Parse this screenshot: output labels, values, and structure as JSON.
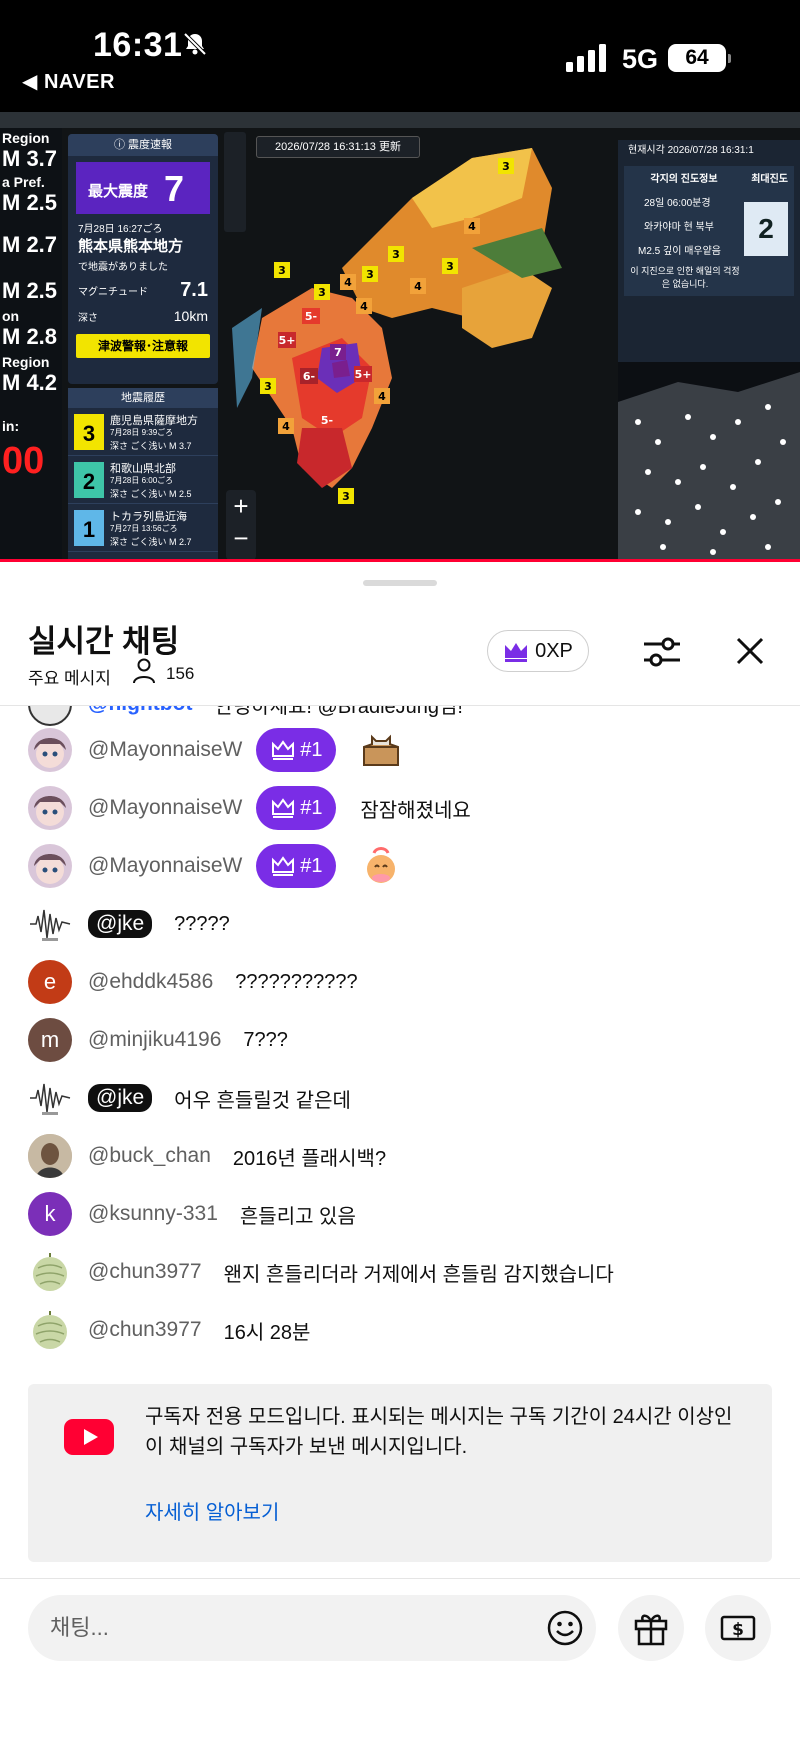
{
  "status_bar": {
    "time": "16:31",
    "back_label": "◀ NAVER",
    "network": "5G",
    "battery": "64"
  },
  "video": {
    "left_labels": [
      "Region",
      "M 3.7",
      "a Pref.",
      "M 2.5",
      "M 2.7",
      "M 2.5",
      "on",
      "M 2.8",
      "Region",
      "M 4.2",
      "in:",
      "00"
    ],
    "panel": {
      "header": "ⓘ 震度速報",
      "max_label": "最大震度",
      "max_value": "7",
      "date": "7月28日 16:27ごろ",
      "place": "熊本県熊本地方",
      "occurred": "で地震がありました",
      "magnitude_label": "マグニチュード",
      "magnitude_value": "7.1",
      "depth_label": "深さ",
      "depth_value": "10km",
      "tsunami": "津波警報･注意報"
    },
    "history": {
      "header": "地震履歴",
      "items": [
        {
          "intensity": "3",
          "color": "#f2e400",
          "place": "鹿児島県薩摩地方",
          "time": "7月28日 9:39ごろ",
          "detail": "深さ ごく浅い  M 3.7"
        },
        {
          "intensity": "2",
          "color": "#3ec5a8",
          "place": "和歌山県北部",
          "time": "7月28日 6:00ごろ",
          "detail": "深さ ごく浅い  M 2.5"
        },
        {
          "intensity": "1",
          "color": "#5fb7e8",
          "place": "トカラ列島近海",
          "time": "7月27日 13:56ごろ",
          "detail": "深さ ごく浅い  M 2.7"
        }
      ]
    },
    "timestamp": "2026/07/28 16:31:13 更新",
    "right_panel": {
      "clock": "현재시각  2026/07/28 16:31:1",
      "header": "각지의 진도정보",
      "col_label": "최대진도",
      "time": "28일 06:00분경",
      "location": "와카야마 현 북부",
      "detail": "M2.5 깊이 매우얕음",
      "note": "이 지진으로 인한 해일의 걱정은 없습니다.",
      "intensity": "2"
    },
    "map_intensities": [
      "3",
      "3",
      "4",
      "3",
      "4",
      "5-",
      "5+",
      "7",
      "6-",
      "5+",
      "4",
      "3",
      "3",
      "4",
      "5-",
      "4",
      "3",
      "3",
      "4",
      "3"
    ]
  },
  "chat": {
    "title": "실시간 채팅",
    "mode": "주요 메시지",
    "viewers": "156",
    "xp": "0XP",
    "messages": [
      {
        "author": "@nightbot",
        "text": "안녕하세요! @BradleJung님!",
        "avatar_color": "#d8d8d8"
      },
      {
        "author": "@MayonnaiseW",
        "badge": "#1",
        "text": "",
        "avatar_color": "#d9c6d9"
      },
      {
        "author": "@MayonnaiseW",
        "badge": "#1",
        "text": "잠잠해졌네요",
        "avatar_color": "#d9c6d9"
      },
      {
        "author": "@MayonnaiseW",
        "badge": "#1",
        "text": "",
        "avatar_color": "#d9c6d9"
      },
      {
        "author": "@jke",
        "text": "?????",
        "avatar_color": "#ffffff"
      },
      {
        "author": "@ehddk4586",
        "avatar_letter": "e",
        "text": "???????????",
        "avatar_color": "#c23b16"
      },
      {
        "author": "@minjiku4196",
        "avatar_letter": "m",
        "text": "7???",
        "avatar_color": "#6d4c41"
      },
      {
        "author": "@jke",
        "text": "어우 흔들릴것 같은데",
        "avatar_color": "#ffffff"
      },
      {
        "author": "@buck_chan",
        "text": "2016년 플래시백?",
        "avatar_color": "#8a7a6a"
      },
      {
        "author": "@ksunny-331",
        "avatar_letter": "k",
        "text": "흔들리고 있음",
        "avatar_color": "#7b2fb8"
      },
      {
        "author": "@chun3977",
        "text": "왠지 흔들리더라 거제에서 흔들림 감지했습니다",
        "avatar_color": "#ffffff"
      },
      {
        "author": "@chun3977",
        "text": "16시 28분",
        "avatar_color": "#ffffff"
      }
    ],
    "notice": {
      "text": "구독자 전용 모드입니다. 표시되는 메시지는 구독 기간이 24시간 이상인 이 채널의 구독자가 보낸 메시지입니다.",
      "link": "자세히 알아보기"
    },
    "input_placeholder": "채팅...",
    "colors": {
      "accent_purple": "#7a2de6",
      "link_blue": "#065fd4",
      "youtube_red": "#ff0033"
    }
  }
}
